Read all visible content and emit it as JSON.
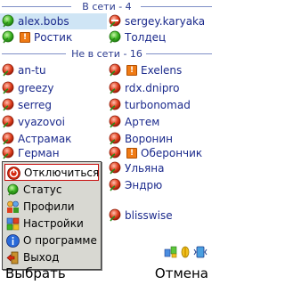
{
  "groups": {
    "online_header": "В сети - 4",
    "offline_header": "Не в сети - 16"
  },
  "online": [
    {
      "left": "alex.bobs",
      "right": "sergey.karyaka"
    },
    {
      "left": "Ростик",
      "right": "Толдец"
    }
  ],
  "offline": [
    {
      "left": "an-tu",
      "right": "Exelens"
    },
    {
      "left": "greezy",
      "right": "rdx.dnipro"
    },
    {
      "left": "serreg",
      "right": "turbonomad"
    },
    {
      "left": "vyazovoi",
      "right": "Артем"
    },
    {
      "left": "Астрамак",
      "right": "Воронин"
    },
    {
      "left": "Герман",
      "right": "Оберончик"
    },
    {
      "left": "",
      "right": "Ульяна"
    },
    {
      "left": "",
      "right": "Эндрю"
    },
    {
      "left": "",
      "right": "blisswise"
    }
  ],
  "menu": {
    "items": [
      {
        "label": "Отключиться",
        "icon": "disconnect-icon"
      },
      {
        "label": "Статус",
        "icon": "status-icon"
      },
      {
        "label": "Профили",
        "icon": "profiles-icon"
      },
      {
        "label": "Настройки",
        "icon": "settings-icon"
      },
      {
        "label": "О программе",
        "icon": "info-icon"
      },
      {
        "label": "Выход",
        "icon": "exit-icon"
      }
    ]
  },
  "softkeys": {
    "left": "Выбрать",
    "right": "Отмена"
  },
  "colors": {
    "accent": "#1b2a8c",
    "selected_row": "#cfe5f5",
    "menu_bg": "#d8d8d2",
    "menu_active_border": "#c81010"
  }
}
